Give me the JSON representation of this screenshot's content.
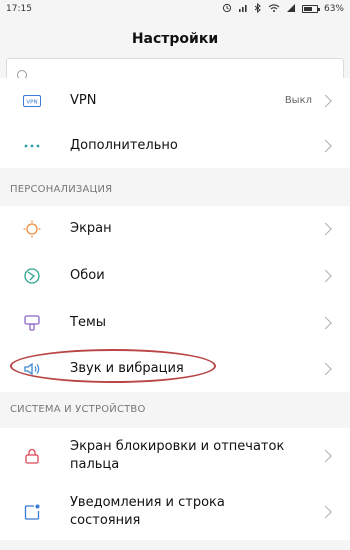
{
  "status_bar": {
    "time": "17:15",
    "battery_text": "63%",
    "battery_level": 0.63
  },
  "header": {
    "title": "Настройки"
  },
  "search": {
    "placeholder": ""
  },
  "top_items": [
    {
      "label": "VPN",
      "value": "Выкл",
      "icon": "vpn-icon",
      "icon_color": "#3a7bd5"
    },
    {
      "label": "Дополнительно",
      "icon": "more-dots-icon",
      "icon_color": "#2a9ea0"
    }
  ],
  "sections": [
    {
      "title": "ПЕРСОНАЛИЗАЦИЯ",
      "items": [
        {
          "label": "Экран",
          "icon": "screen-brightness-icon",
          "icon_color": "#f08a3c"
        },
        {
          "label": "Обои",
          "icon": "wallpaper-icon",
          "icon_color": "#2ba38e"
        },
        {
          "label": "Темы",
          "icon": "themes-icon",
          "icon_color": "#8b69c9"
        },
        {
          "label": "Звук и вибрация",
          "icon": "speaker-icon",
          "icon_color": "#3a88d0"
        }
      ]
    },
    {
      "title": "СИСТЕМА И УСТРОЙСТВО",
      "items": [
        {
          "label": "Экран блокировки и отпечаток пальца",
          "icon": "lock-icon",
          "icon_color": "#e0475b"
        },
        {
          "label": "Уведомления и строка состояния",
          "icon": "notification-icon",
          "icon_color": "#3a7bd5"
        }
      ]
    }
  ]
}
